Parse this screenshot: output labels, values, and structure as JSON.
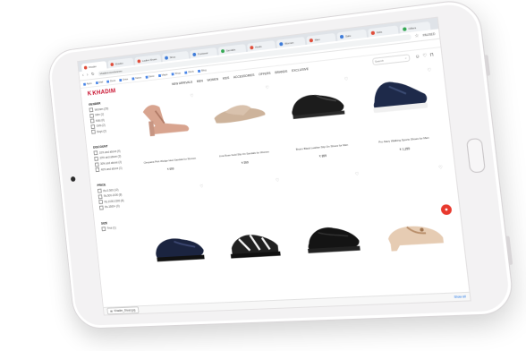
{
  "browser": {
    "tabs": [
      {
        "label": "Khadim",
        "dot": "red",
        "active": true
      },
      {
        "label": "Khadim",
        "dot": "red"
      },
      {
        "label": "Ladies Shoes",
        "dot": "red"
      },
      {
        "label": "Shop",
        "dot": "blue"
      },
      {
        "label": "Footwear",
        "dot": "blue"
      },
      {
        "label": "Sandals",
        "dot": "green"
      },
      {
        "label": "Heels",
        "dot": "red"
      },
      {
        "label": "Women",
        "dot": "blue"
      },
      {
        "label": "Men",
        "dot": "red"
      },
      {
        "label": "Sale",
        "dot": "blue"
      },
      {
        "label": "Kids",
        "dot": "red"
      },
      {
        "label": "Offers",
        "dot": "green"
      }
    ],
    "url": "khadims.com/women",
    "bookmarks": [
      "Apps",
      "Mail",
      "Docs",
      "Drive",
      "News",
      "Store",
      "Maps",
      "Shop",
      "Work",
      "Blog"
    ],
    "account_label": "PAUSED"
  },
  "site": {
    "logo": "KHADIM",
    "nav": [
      "New arrivals",
      "Men",
      "Women",
      "Kids",
      "Accessories",
      "Offers",
      "Brands",
      "Exclusive"
    ],
    "search_placeholder": "Search"
  },
  "filters": [
    {
      "title": "Gender",
      "options": [
        "Women (29)",
        "Men (1)",
        "Kids (0)",
        "Girls (2)",
        "Boys (2)"
      ]
    },
    {
      "title": "Discount",
      "options": [
        "10% and above (4)",
        "20% and above (3)",
        "30% and above (2)",
        "40% and above (1)"
      ]
    },
    {
      "title": "Price",
      "options": [
        "Rs.0-500 (12)",
        "Rs.500-1000 (8)",
        "Rs.1000-1500 (6)",
        "Rs.1500+ (3)"
      ]
    },
    {
      "title": "Size",
      "options": [
        "Free (1)"
      ]
    }
  ],
  "products": [
    {
      "name": "Cleopatra Pink Wedge Heel Sandals for Women",
      "price": "₹ 699",
      "shoe": "heel-sandal"
    },
    {
      "name": "Lina Rose Gold Slip On Sandals for Women",
      "price": "₹ 599",
      "shoe": "slide"
    },
    {
      "name": "Bruno Black Leather Slip On Shoes for Men",
      "price": "₹ 899",
      "shoe": "loafer"
    },
    {
      "name": "Pro Navy Walking Sports Shoes for Men",
      "price": "₹ 1,299",
      "shoe": "sneaker"
    },
    {
      "name": "",
      "price": "",
      "shoe": "navy-loafer"
    },
    {
      "name": "",
      "price": "",
      "shoe": "sport-sandal"
    },
    {
      "name": "",
      "price": "",
      "shoe": "black-slip-on"
    },
    {
      "name": "",
      "price": "",
      "shoe": "beige-mule"
    }
  ],
  "download": {
    "file": "Khadim_Shoes.jpg",
    "show_all": "Show all"
  },
  "colors": {
    "brand": "#c8102e",
    "fab": "#e8392e"
  }
}
